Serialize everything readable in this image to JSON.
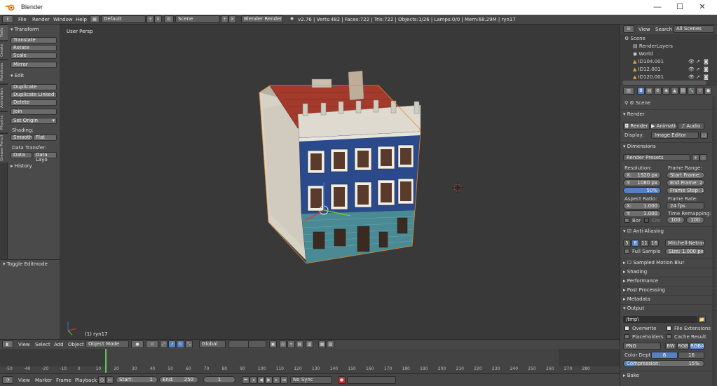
{
  "window": {
    "title": "Blender",
    "minimize": "—",
    "maximize": "☐",
    "close": "✕"
  },
  "infobar": {
    "menus": [
      "File",
      "Render",
      "Window",
      "Help"
    ],
    "layout": "Default",
    "scene": "Scene",
    "engine": "Blender Render",
    "stats": "v2.76 | Verts:482 | Faces:722 | Tris:722 | Objects:1/26 | Lamps:0/0 | Mem:68.29M | ryn17"
  },
  "tabs": [
    "Tools",
    "Create",
    "Relations",
    "Animation",
    "Physics",
    "Grease Pencil"
  ],
  "toolshelf": {
    "transform_header": "Transform",
    "transform": [
      "Translate",
      "Rotate",
      "Scale"
    ],
    "mirror": "Mirror",
    "edit_header": "Edit",
    "edit": [
      "Duplicate",
      "Duplicate Linked",
      "Delete"
    ],
    "join": "Join",
    "set_origin": "Set Origin",
    "shading_label": "Shading:",
    "smooth": "Smooth",
    "flat": "Flat",
    "data_transfer_label": "Data Transfer:",
    "data": "Data",
    "data_layout": "Data Layo",
    "history": "History",
    "toggle_editmode": "Toggle Editmode"
  },
  "viewport": {
    "view_label": "User Persp",
    "object_label": "(1) ryn17"
  },
  "v3d_header": {
    "menus": [
      "View",
      "Select",
      "Add",
      "Object"
    ],
    "mode": "Object Mode",
    "orientation": "Global"
  },
  "timeline": {
    "ticks": [
      "-50",
      "-40",
      "-20",
      "-10",
      "0",
      "10",
      "20",
      "30",
      "40",
      "50",
      "60",
      "70",
      "80",
      "90",
      "100",
      "110",
      "120",
      "130",
      "140",
      "150",
      "160",
      "170",
      "180",
      "190",
      "200",
      "210",
      "220",
      "230",
      "240",
      "250",
      "260",
      "270",
      "280"
    ],
    "menus": [
      "View",
      "Marker",
      "Frame",
      "Playback"
    ],
    "start": "Start:",
    "start_val": "1",
    "end": "End:",
    "end_val": "250",
    "current": "1",
    "sync": "No Sync"
  },
  "outliner": {
    "menus": [
      "View",
      "Search"
    ],
    "filter": "All Scenes",
    "items": [
      "Scene",
      "RenderLayers",
      "World",
      "ID104.001",
      "ID12.001",
      "ID120.001"
    ]
  },
  "properties": {
    "scene_label": "Scene",
    "render_header": "Render",
    "render_btns": [
      "Render",
      "Animation",
      "Audio"
    ],
    "display_label": "Display:",
    "display_value": "Image Editor",
    "dimensions_header": "Dimensions",
    "render_presets": "Render Presets",
    "resolution_label": "Resolution:",
    "res_x": "X:",
    "res_x_val": "1920 px",
    "res_y": "Y:",
    "res_y_val": "1080 px",
    "res_pct": "50%",
    "frame_range_label": "Frame Range:",
    "start_frame": "Start Frame: 1",
    "end_frame": "End Frame: 250",
    "frame_step": "Frame Step: 1",
    "aspect_label": "Aspect Ratio:",
    "aspect_x": "X:",
    "aspect_x_val": "1.000",
    "aspect_y": "Y:",
    "aspect_y_val": "1.000",
    "frame_rate_label": "Frame Rate:",
    "fps": "24 fps",
    "time_remap_label": "Time Remapping:",
    "remap_old": "100",
    "remap_new": "100",
    "border": "Bor",
    "crop": "Cro",
    "aa_header": "Anti-Aliasing",
    "aa_samples": [
      "5",
      "8",
      "11",
      "16"
    ],
    "aa_filter": "Mitchell-Netrav...",
    "full_sample": "Full Sample",
    "size": "Size: 1.000 px",
    "collapsed": [
      "Sampled Motion Blur",
      "Shading",
      "Performance",
      "Post Processing",
      "Metadata"
    ],
    "output_header": "Output",
    "output_path": "/tmp\\",
    "overwrite": "Overwrite",
    "file_extensions": "File Extensions",
    "placeholders": "Placeholders",
    "cache_result": "Cache Result",
    "format": "PNG",
    "color_modes": [
      "BW",
      "RGB",
      "RGBA"
    ],
    "color_depth_label": "Color Depth:",
    "depths": [
      "8",
      "16"
    ],
    "compression": "Compression:",
    "compression_val": "15%",
    "bake": "Bake"
  },
  "colors": {
    "selected_blue": "#5680c2",
    "frame_green": "#63c35a",
    "roof_red": "#a33a2c",
    "facade_blue": "#2a4a8c"
  }
}
